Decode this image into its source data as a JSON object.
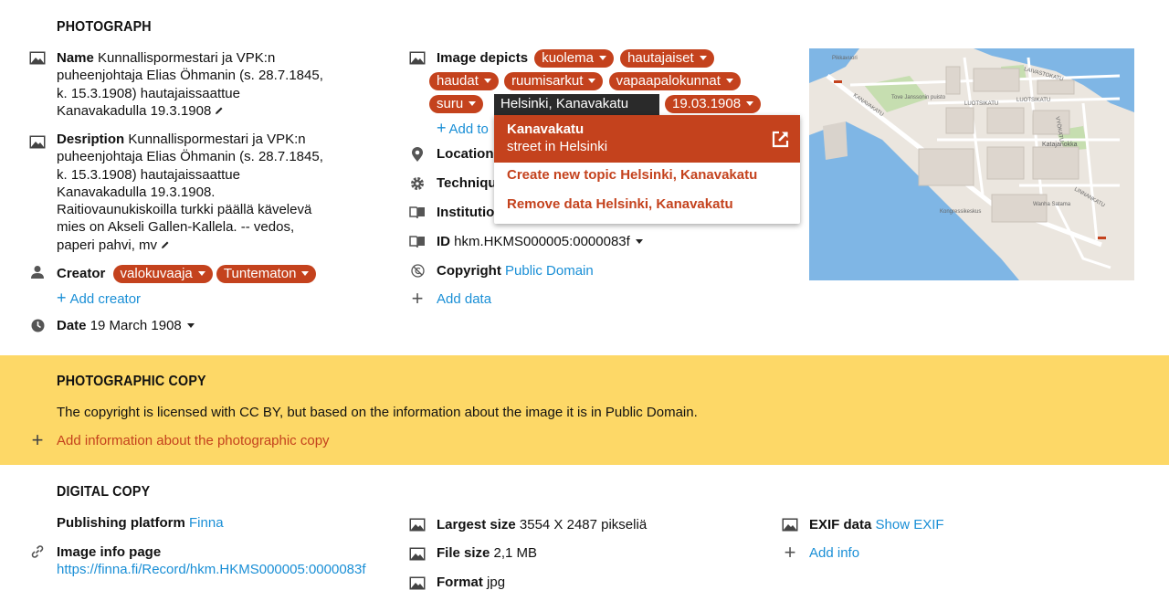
{
  "photograph": {
    "heading": "PHOTOGRAPH",
    "name_label": "Name",
    "name_lines": [
      "Kunnallispormestari ja VPK:n",
      "puheenjohtaja Elias Öhmanin (s. 28.7.1845,",
      "k. 15.3.1908) hautajaissaattue",
      "Kanavakadulla 19.3.1908"
    ],
    "description_label": "Desription",
    "description_lines": [
      "Kunnallispormestari ja VPK:n",
      "puheenjohtaja Elias Öhmanin (s. 28.7.1845,",
      "k. 15.3.1908) hautajaissaattue",
      "Kanavakadulla 19.3.1908.",
      "Raitiovaunukiskoilla turkki päällä kävelevä",
      "mies on Akseli Gallen-Kallela. -- vedos,",
      "paperi pahvi, mv"
    ],
    "creator_label": "Creator",
    "creator_tags": [
      "valokuvaaja",
      "Tuntematon"
    ],
    "add_creator": "Add creator",
    "date_label": "Date",
    "date_value": "19 March 1908",
    "image_depicts_label": "Image depicts",
    "depicts_tags_row1": [
      "kuolema",
      "hautajaiset"
    ],
    "depicts_tags_row2": [
      "haudat",
      "ruumisarkut",
      "vapaapalokunnat"
    ],
    "depicts_tags_row3_a": "suru",
    "depicts_input_value": "Helsinki, Kanavakatu",
    "depicts_tags_row3_b": "19.03.1908",
    "add_topic_partial": "Add to",
    "location_label": "Location",
    "technique_label": "Techniqu",
    "institution_label": "Institution",
    "id_label": "ID",
    "id_value": "hkm.HKMS000005:0000083f",
    "copyright_label": "Copyright",
    "copyright_value": "Public Domain",
    "add_data": "Add data"
  },
  "dropdown": {
    "title": "Kanavakatu",
    "subtitle": "street in Helsinki",
    "create_topic": "Create new topic Helsinki, Kanavakatu",
    "remove_data": "Remove data Helsinki, Kanavakatu"
  },
  "map": {
    "labels": [
      "Pikkavuori",
      "LAIVASTOKATU",
      "KANAVAKATU",
      "LUOTSIKATU",
      "LUOTSIKATU",
      "Tove Janssonin puisto",
      "VYÖKATU",
      "Katajanokka",
      "LINNANKATU",
      "Wanha Satama",
      "Kongressikeskus"
    ]
  },
  "photographic_copy": {
    "heading": "PHOTOGRAPHIC COPY",
    "note": "The copyright is licensed with CC BY, but based on the information about the image it is in Public Domain.",
    "add_info": "Add information about the photographic copy"
  },
  "digital_copy": {
    "heading": "DIGITAL COPY",
    "platform_label": "Publishing platform",
    "platform_value": "Finna",
    "info_page_label": "Image info page",
    "info_page_url": "https://finna.fi/Record/hkm.HKMS000005:0000083f",
    "largest_size_label": "Largest size",
    "largest_size_value": "3554 X 2487 pikseliä",
    "file_size_label": "File size",
    "file_size_value": "2,1 MB",
    "format_label": "Format",
    "format_value": "jpg",
    "exif_label": "EXIF data",
    "exif_value": "Show EXIF",
    "add_info": "Add info"
  },
  "colors": {
    "tag": "#c4421d",
    "link": "#1a8fd6",
    "yellow_band": "#fdd867",
    "add_link_orange": "#c4421d"
  }
}
